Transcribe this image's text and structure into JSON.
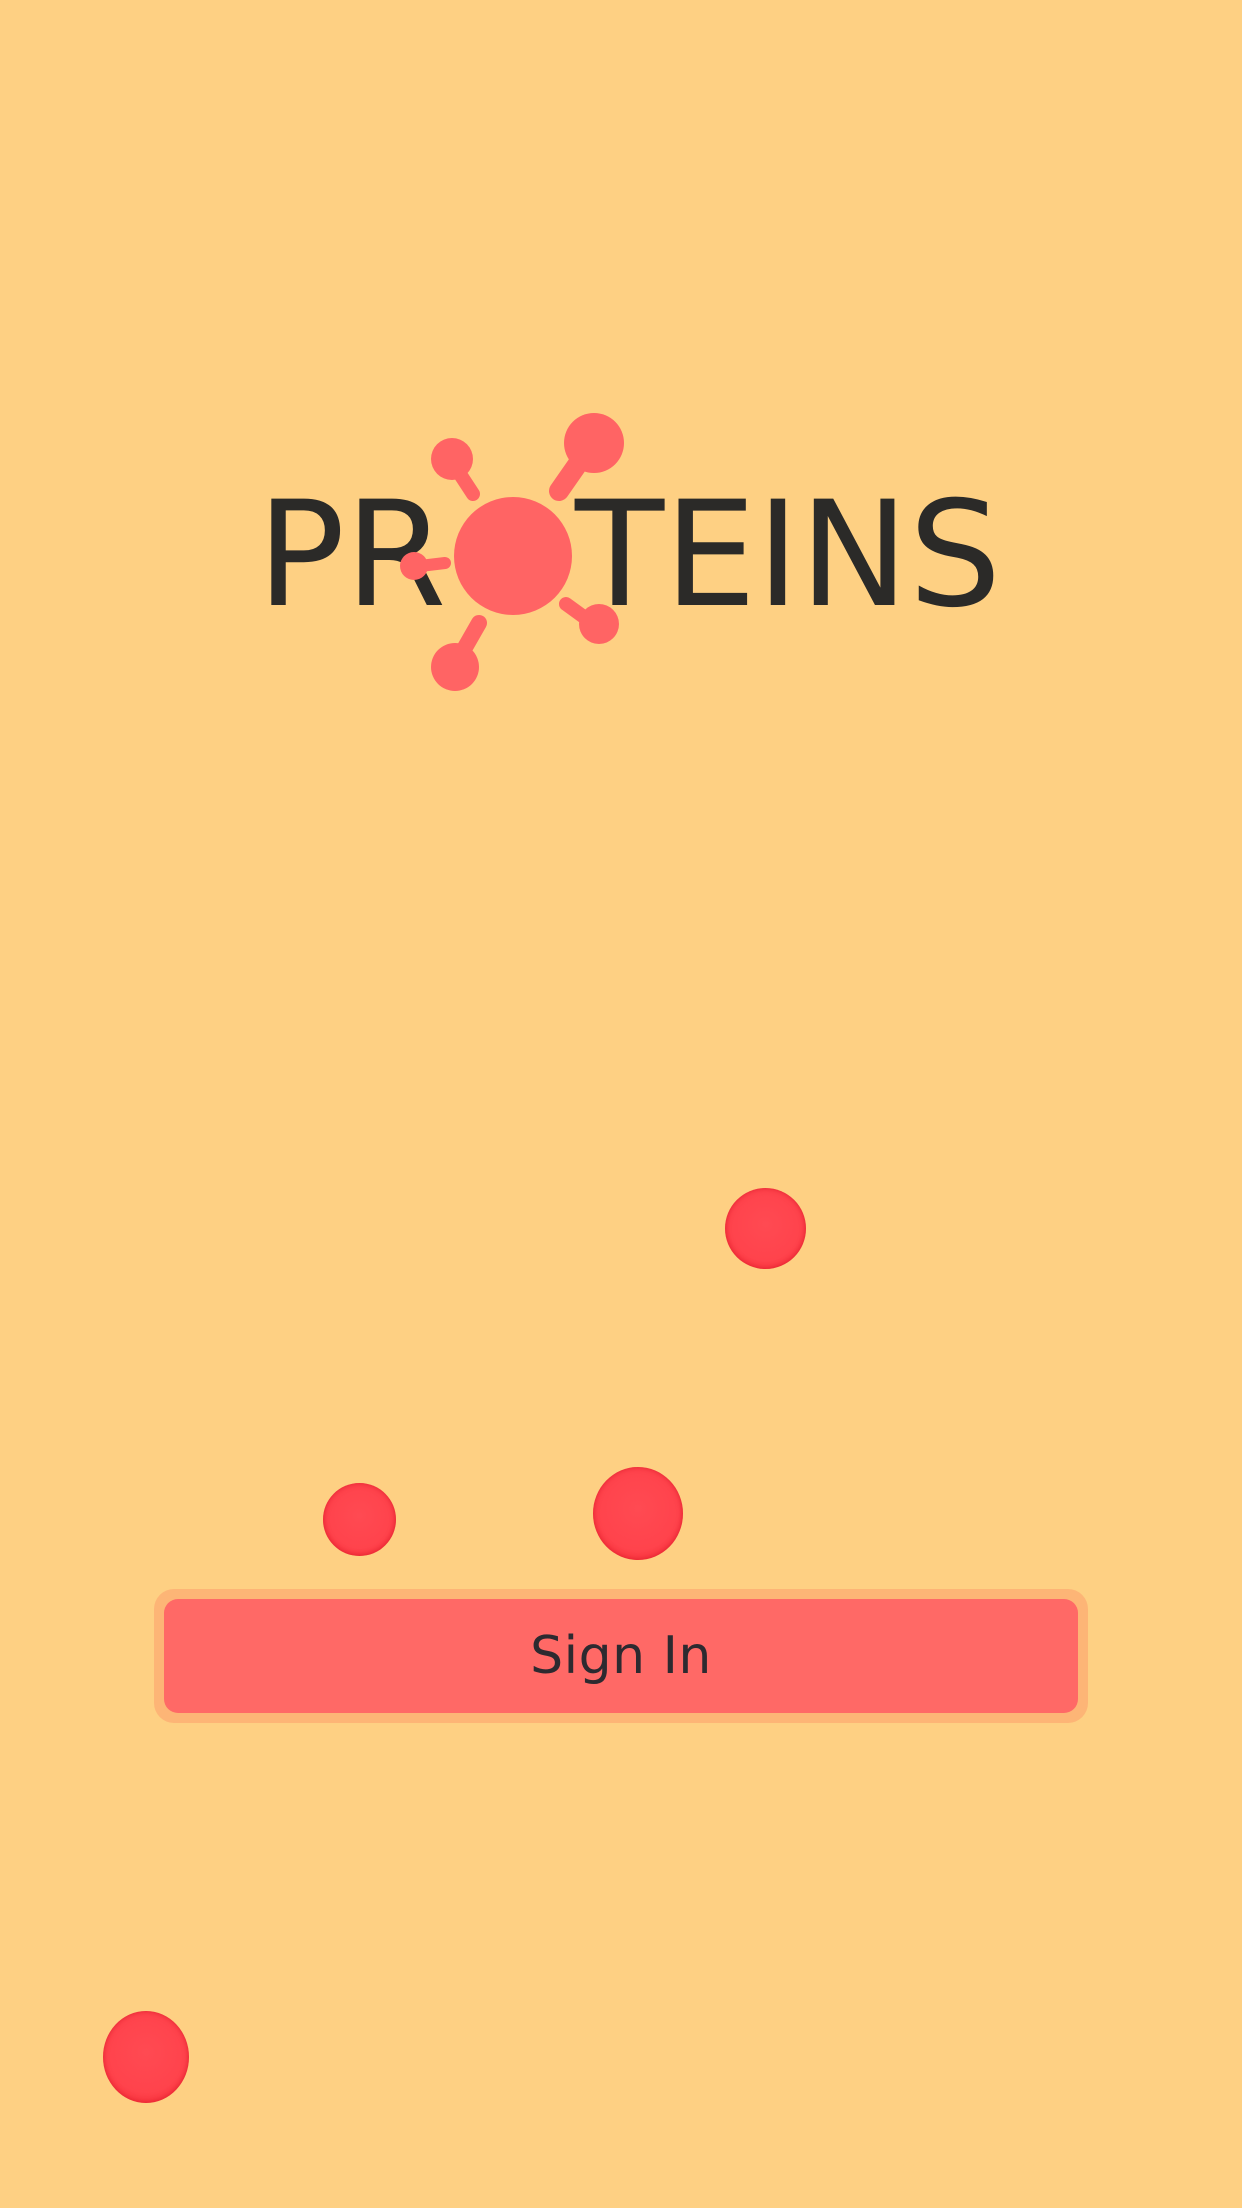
{
  "brand": {
    "title": "PROTEINS",
    "logo_icon": "protein-molecule-icon",
    "text_color": "#2B2A28",
    "logo_color": "#FF6464"
  },
  "signin": {
    "label": "Sign In",
    "button_color": "#FF6966",
    "border_color": "#FDB576"
  },
  "background": {
    "color": "#FED083",
    "bubble_color": "#FF434C",
    "decorations": [
      "red-bubble",
      "red-bubble",
      "red-bubble",
      "red-bubble"
    ]
  }
}
